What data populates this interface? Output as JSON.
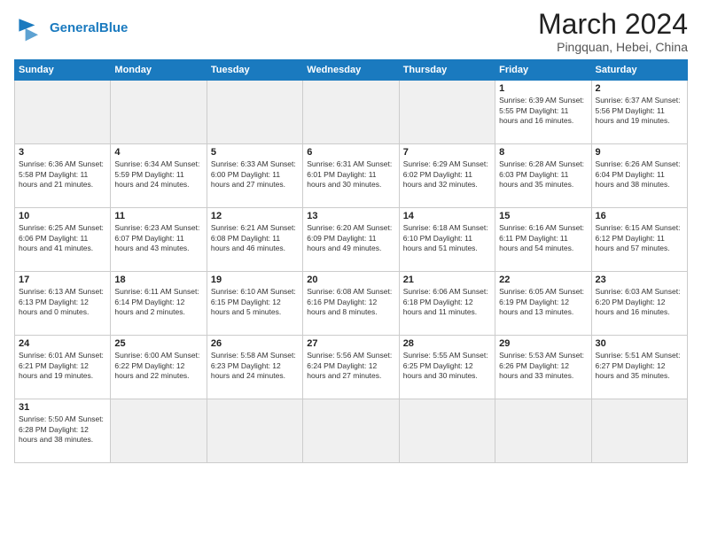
{
  "header": {
    "logo_general": "General",
    "logo_blue": "Blue",
    "month_title": "March 2024",
    "location": "Pingquan, Hebei, China"
  },
  "weekdays": [
    "Sunday",
    "Monday",
    "Tuesday",
    "Wednesday",
    "Thursday",
    "Friday",
    "Saturday"
  ],
  "weeks": [
    [
      {
        "day": "",
        "info": "",
        "empty": true
      },
      {
        "day": "",
        "info": "",
        "empty": true
      },
      {
        "day": "",
        "info": "",
        "empty": true
      },
      {
        "day": "",
        "info": "",
        "empty": true
      },
      {
        "day": "",
        "info": "",
        "empty": true
      },
      {
        "day": "1",
        "info": "Sunrise: 6:39 AM\nSunset: 5:55 PM\nDaylight: 11 hours\nand 16 minutes."
      },
      {
        "day": "2",
        "info": "Sunrise: 6:37 AM\nSunset: 5:56 PM\nDaylight: 11 hours\nand 19 minutes."
      }
    ],
    [
      {
        "day": "3",
        "info": "Sunrise: 6:36 AM\nSunset: 5:58 PM\nDaylight: 11 hours\nand 21 minutes."
      },
      {
        "day": "4",
        "info": "Sunrise: 6:34 AM\nSunset: 5:59 PM\nDaylight: 11 hours\nand 24 minutes."
      },
      {
        "day": "5",
        "info": "Sunrise: 6:33 AM\nSunset: 6:00 PM\nDaylight: 11 hours\nand 27 minutes."
      },
      {
        "day": "6",
        "info": "Sunrise: 6:31 AM\nSunset: 6:01 PM\nDaylight: 11 hours\nand 30 minutes."
      },
      {
        "day": "7",
        "info": "Sunrise: 6:29 AM\nSunset: 6:02 PM\nDaylight: 11 hours\nand 32 minutes."
      },
      {
        "day": "8",
        "info": "Sunrise: 6:28 AM\nSunset: 6:03 PM\nDaylight: 11 hours\nand 35 minutes."
      },
      {
        "day": "9",
        "info": "Sunrise: 6:26 AM\nSunset: 6:04 PM\nDaylight: 11 hours\nand 38 minutes."
      }
    ],
    [
      {
        "day": "10",
        "info": "Sunrise: 6:25 AM\nSunset: 6:06 PM\nDaylight: 11 hours\nand 41 minutes."
      },
      {
        "day": "11",
        "info": "Sunrise: 6:23 AM\nSunset: 6:07 PM\nDaylight: 11 hours\nand 43 minutes."
      },
      {
        "day": "12",
        "info": "Sunrise: 6:21 AM\nSunset: 6:08 PM\nDaylight: 11 hours\nand 46 minutes."
      },
      {
        "day": "13",
        "info": "Sunrise: 6:20 AM\nSunset: 6:09 PM\nDaylight: 11 hours\nand 49 minutes."
      },
      {
        "day": "14",
        "info": "Sunrise: 6:18 AM\nSunset: 6:10 PM\nDaylight: 11 hours\nand 51 minutes."
      },
      {
        "day": "15",
        "info": "Sunrise: 6:16 AM\nSunset: 6:11 PM\nDaylight: 11 hours\nand 54 minutes."
      },
      {
        "day": "16",
        "info": "Sunrise: 6:15 AM\nSunset: 6:12 PM\nDaylight: 11 hours\nand 57 minutes."
      }
    ],
    [
      {
        "day": "17",
        "info": "Sunrise: 6:13 AM\nSunset: 6:13 PM\nDaylight: 12 hours\nand 0 minutes."
      },
      {
        "day": "18",
        "info": "Sunrise: 6:11 AM\nSunset: 6:14 PM\nDaylight: 12 hours\nand 2 minutes."
      },
      {
        "day": "19",
        "info": "Sunrise: 6:10 AM\nSunset: 6:15 PM\nDaylight: 12 hours\nand 5 minutes."
      },
      {
        "day": "20",
        "info": "Sunrise: 6:08 AM\nSunset: 6:16 PM\nDaylight: 12 hours\nand 8 minutes."
      },
      {
        "day": "21",
        "info": "Sunrise: 6:06 AM\nSunset: 6:18 PM\nDaylight: 12 hours\nand 11 minutes."
      },
      {
        "day": "22",
        "info": "Sunrise: 6:05 AM\nSunset: 6:19 PM\nDaylight: 12 hours\nand 13 minutes."
      },
      {
        "day": "23",
        "info": "Sunrise: 6:03 AM\nSunset: 6:20 PM\nDaylight: 12 hours\nand 16 minutes."
      }
    ],
    [
      {
        "day": "24",
        "info": "Sunrise: 6:01 AM\nSunset: 6:21 PM\nDaylight: 12 hours\nand 19 minutes."
      },
      {
        "day": "25",
        "info": "Sunrise: 6:00 AM\nSunset: 6:22 PM\nDaylight: 12 hours\nand 22 minutes."
      },
      {
        "day": "26",
        "info": "Sunrise: 5:58 AM\nSunset: 6:23 PM\nDaylight: 12 hours\nand 24 minutes."
      },
      {
        "day": "27",
        "info": "Sunrise: 5:56 AM\nSunset: 6:24 PM\nDaylight: 12 hours\nand 27 minutes."
      },
      {
        "day": "28",
        "info": "Sunrise: 5:55 AM\nSunset: 6:25 PM\nDaylight: 12 hours\nand 30 minutes."
      },
      {
        "day": "29",
        "info": "Sunrise: 5:53 AM\nSunset: 6:26 PM\nDaylight: 12 hours\nand 33 minutes."
      },
      {
        "day": "30",
        "info": "Sunrise: 5:51 AM\nSunset: 6:27 PM\nDaylight: 12 hours\nand 35 minutes."
      }
    ],
    [
      {
        "day": "31",
        "info": "Sunrise: 5:50 AM\nSunset: 6:28 PM\nDaylight: 12 hours\nand 38 minutes."
      },
      {
        "day": "",
        "info": "",
        "empty": true
      },
      {
        "day": "",
        "info": "",
        "empty": true
      },
      {
        "day": "",
        "info": "",
        "empty": true
      },
      {
        "day": "",
        "info": "",
        "empty": true
      },
      {
        "day": "",
        "info": "",
        "empty": true
      },
      {
        "day": "",
        "info": "",
        "empty": true
      }
    ]
  ]
}
